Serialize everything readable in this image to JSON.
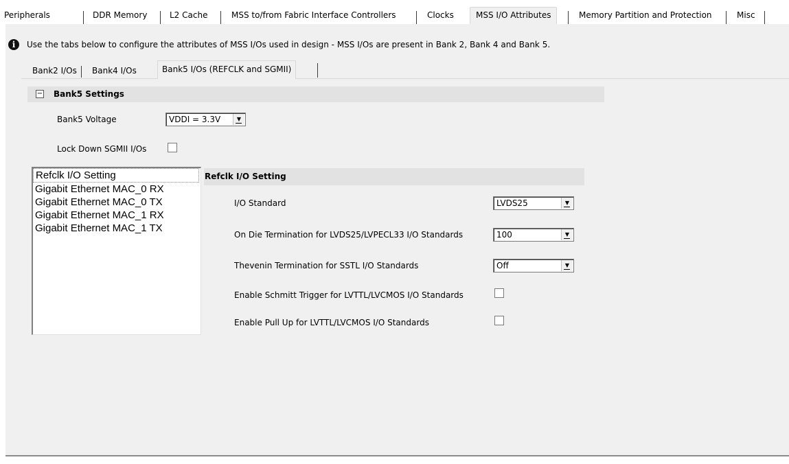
{
  "top_tabs": [
    "Peripherals",
    "DDR Memory",
    "L2 Cache",
    "MSS to/from Fabric Interface Controllers",
    "Clocks",
    "MSS I/O Attributes",
    "Memory Partition and Protection",
    "Misc"
  ],
  "info": "Use the tabs below to configure the attributes of MSS I/Os used in design - MSS I/Os are present in Bank 2, Bank 4 and Bank 5.",
  "sub_tabs": [
    "Bank2 I/Os",
    "Bank4 I/Os",
    "Bank5 I/Os (REFCLK and SGMII)"
  ],
  "bank5": {
    "title": "Bank5 Settings",
    "collapse": "−",
    "voltage_label": "Bank5 Voltage",
    "voltage_value": "VDDI = 3.3V",
    "lock_label": "Lock Down SGMII I/Os"
  },
  "list_items": [
    "Refclk I/O Setting",
    "Gigabit Ethernet MAC_0 RX",
    "Gigabit Ethernet MAC_0 TX",
    "Gigabit Ethernet MAC_1 RX",
    "Gigabit Ethernet MAC_1 TX"
  ],
  "refclk": {
    "title": "Refclk I/O Setting",
    "io_standard_label": "I/O Standard",
    "io_standard_value": "LVDS25",
    "odt_label": "On Die Termination for LVDS25/LVPECL33 I/O Standards",
    "odt_value": "100",
    "thevenin_label": "Thevenin Termination for SSTL I/O Standards",
    "thevenin_value": "Off",
    "schmitt_label": "Enable Schmitt Trigger for LVTTL/LVCMOS I/O Standards",
    "pullup_label": "Enable Pull Up for LVTTL/LVCMOS I/O Standards"
  }
}
